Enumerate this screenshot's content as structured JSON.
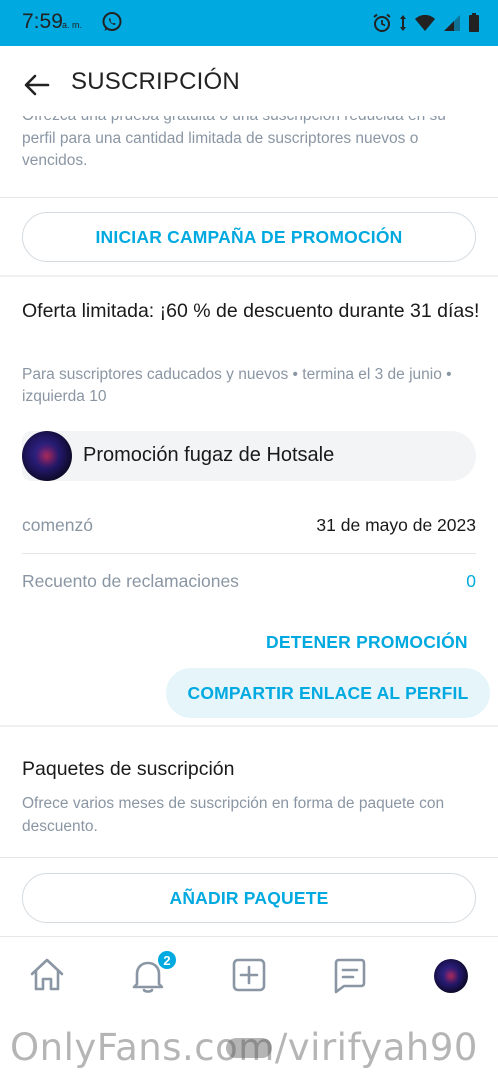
{
  "status_bar": {
    "time": "7:59",
    "ampm": "a. m.",
    "icons": [
      "whatsapp-icon",
      "alarm-icon",
      "data-arrows-icon",
      "wifi-icon",
      "signal-icon",
      "battery-icon"
    ],
    "color": "#00a9e0"
  },
  "header": {
    "title": "SUSCRIPCIÓN",
    "back_icon": "arrow-left-icon"
  },
  "intro": {
    "hidden_line": "Ofrezca una prueba gratuita o una suscripción reducida en su",
    "description": "perfil para una cantidad limitada de suscriptores nuevos o vencidos."
  },
  "campaign_button": "INICIAR CAMPAÑA DE PROMOCIÓN",
  "promotion": {
    "title": "Oferta limitada: ¡60 % de descuento durante 31 días!",
    "meta": "Para suscriptores caducados y nuevos  •  termina el 3 de junio  •  izquierda 10",
    "name": "Promoción fugaz de Hotsale",
    "started_label": "comenzó",
    "started_value": "31 de mayo de 2023",
    "claims_label": "Recuento de reclamaciones",
    "claims_value": "0",
    "stop_button": "DETENER PROMOCIÓN",
    "share_button": "COMPARTIR ENLACE AL PERFIL"
  },
  "packages": {
    "title": "Paquetes de suscripción",
    "description": "Ofrece varios meses de suscripción en forma de paquete con descuento.",
    "add_button": "AÑADIR PAQUETE"
  },
  "bottom_nav": {
    "items": [
      "home-icon",
      "notifications-icon",
      "add-post-icon",
      "messages-icon",
      "profile-avatar"
    ],
    "notification_count": "2"
  },
  "watermark": "OnlyFans.com/virifyah90",
  "colors": {
    "accent": "#00a9e0",
    "muted_text": "#8a96a3",
    "text": "#1a1a1a"
  }
}
